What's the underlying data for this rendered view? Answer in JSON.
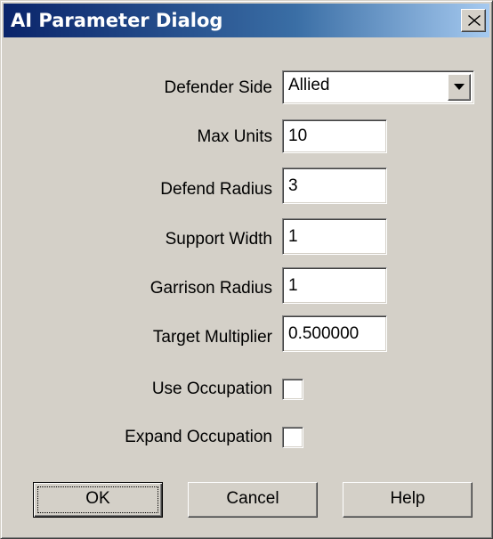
{
  "window": {
    "title": "AI Parameter Dialog",
    "close_glyph": "close-icon"
  },
  "fields": {
    "defender_side": {
      "label": "Defender Side",
      "value": "Allied"
    },
    "max_units": {
      "label": "Max Units",
      "value": "10"
    },
    "defend_radius": {
      "label": "Defend Radius",
      "value": "3"
    },
    "support_width": {
      "label": "Support Width",
      "value": "1"
    },
    "garrison_radius": {
      "label": "Garrison Radius",
      "value": "1"
    },
    "target_multiplier": {
      "label": "Target Multiplier",
      "value": "0.500000"
    },
    "use_occupation": {
      "label": "Use Occupation",
      "checked": false
    },
    "expand_occupation": {
      "label": "Expand Occupation",
      "checked": false
    }
  },
  "buttons": {
    "ok": "OK",
    "cancel": "Cancel",
    "help": "Help"
  },
  "colors": {
    "title_start": "#0a246a",
    "title_end": "#a6caf0",
    "face": "#d4d0c8"
  }
}
